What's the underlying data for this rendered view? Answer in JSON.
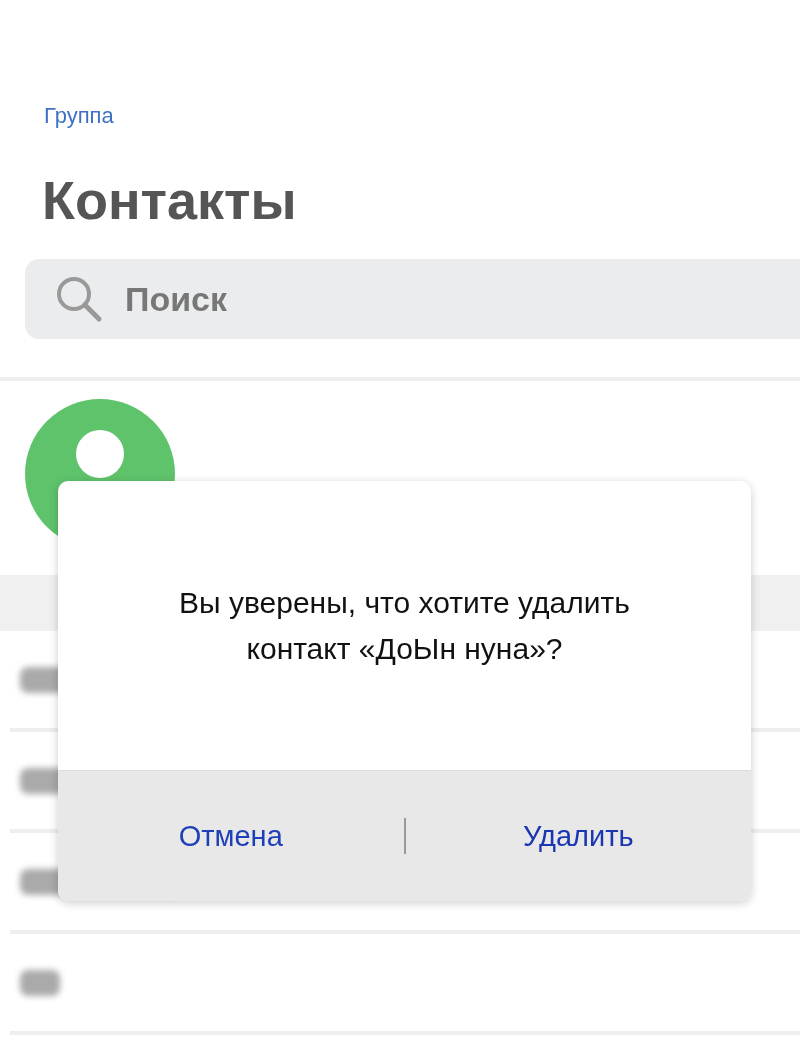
{
  "background": {
    "back_link": "Группа",
    "title": "Контакты",
    "search": {
      "placeholder": "Поиск"
    }
  },
  "dialog": {
    "message": "Вы уверены, что хотите удалить контакт «ДоЫн нуна»?",
    "buttons": [
      {
        "label": "Отмена",
        "kind": "cancel"
      },
      {
        "label": "Удалить",
        "kind": "destructive"
      }
    ]
  }
}
